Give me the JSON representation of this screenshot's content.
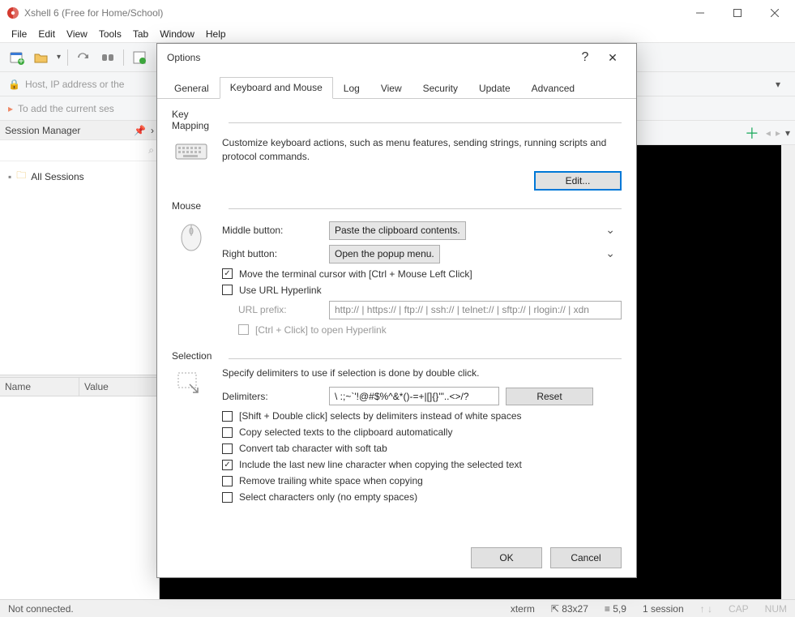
{
  "window": {
    "title": "Xshell 6 (Free for Home/School)"
  },
  "menubar": [
    "File",
    "Edit",
    "View",
    "Tools",
    "Tab",
    "Window",
    "Help"
  ],
  "address": {
    "placeholder": "Host, IP address or the",
    "hint": "To add the current ses"
  },
  "session_manager": {
    "title": "Session Manager",
    "root": "All Sessions"
  },
  "properties": {
    "cols": [
      "Name",
      "Value"
    ]
  },
  "statusbar": {
    "conn": "Not connected.",
    "term": "xterm",
    "size": "83x27",
    "pos": "5,9",
    "sess": "1 session",
    "cap": "CAP",
    "num": "NUM"
  },
  "dialog": {
    "title": "Options",
    "tabs": [
      "General",
      "Keyboard and Mouse",
      "Log",
      "View",
      "Security",
      "Update",
      "Advanced"
    ],
    "active_tab": "Keyboard and Mouse",
    "keymapping": {
      "label": "Key Mapping",
      "desc": "Customize keyboard actions, such as menu features, sending strings, running scripts and protocol commands.",
      "edit": "Edit..."
    },
    "mouse": {
      "label": "Mouse",
      "middle_lbl": "Middle button:",
      "middle_val": "Paste the clipboard contents.",
      "right_lbl": "Right button:",
      "right_val": "Open the popup menu.",
      "move_cursor": "Move the terminal cursor with [Ctrl + Mouse Left Click]",
      "use_url": "Use URL Hyperlink",
      "url_prefix_lbl": "URL prefix:",
      "url_prefix_val": "http:// | https:// | ftp:// | ssh:// | telnet:// | sftp:// | rlogin:// | xdn",
      "ctrl_click": "[Ctrl + Click] to open Hyperlink"
    },
    "selection": {
      "label": "Selection",
      "desc": "Specify delimiters to use if selection is done by double click.",
      "delim_lbl": "Delimiters:",
      "delim_val": "\\ :;~`'!@#$%^&*()-=+|[]{}'\"..<>/?",
      "reset": "Reset",
      "shift_dbl": "[Shift + Double click] selects by delimiters instead of white spaces",
      "copy_auto": "Copy selected texts to the clipboard automatically",
      "convert_tab": "Convert tab character with soft tab",
      "include_nl": "Include the last new line character when copying the selected text",
      "trim_ws": "Remove trailing white space when copying",
      "sel_chars": "Select characters only (no empty spaces)"
    },
    "ok": "OK",
    "cancel": "Cancel"
  }
}
